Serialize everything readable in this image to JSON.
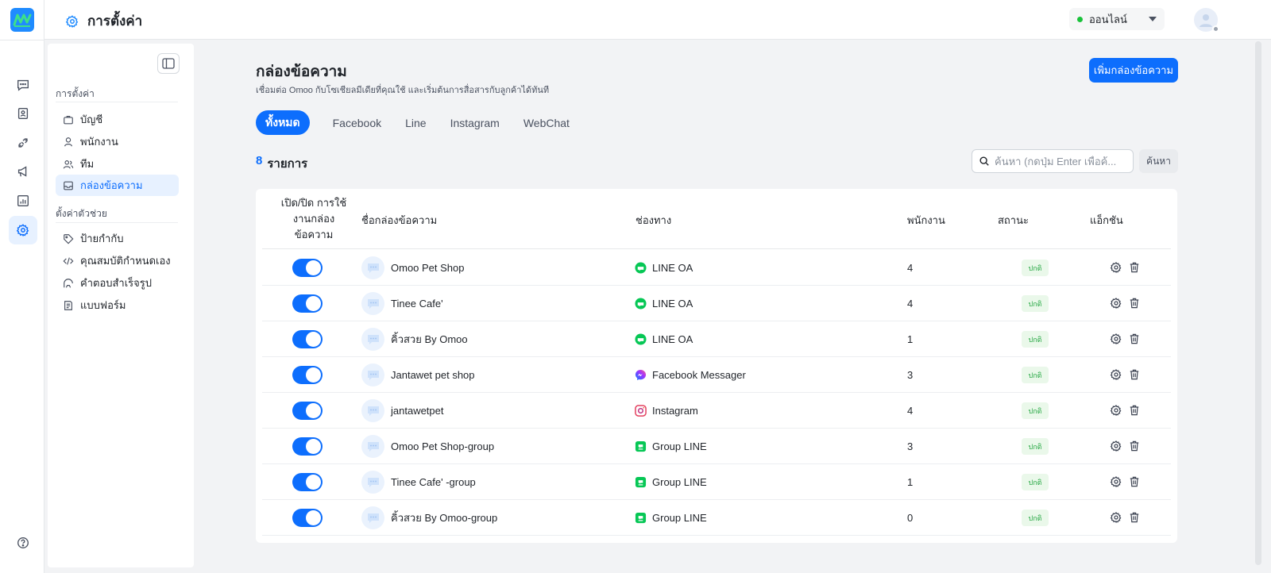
{
  "app": {
    "title": "การตั้งค่า"
  },
  "status": {
    "label": "ออนไลน์"
  },
  "settings_sidebar": {
    "group1": "การตั้งค่า",
    "items1": [
      {
        "label": "บัญชี"
      },
      {
        "label": "พนักงาน"
      },
      {
        "label": "ทีม"
      },
      {
        "label": "กล่องข้อความ"
      }
    ],
    "group2": "ตั้งค่าตัวช่วย",
    "items2": [
      {
        "label": "ป้ายกำกับ"
      },
      {
        "label": "คุณสมบัติกำหนดเอง"
      },
      {
        "label": "คำตอบสำเร็จรูป"
      },
      {
        "label": "แบบฟอร์ม"
      }
    ]
  },
  "main": {
    "title": "กล่องข้อความ",
    "subtitle": "เชื่อมต่อ Omoo กับโซเชียลมีเดียที่คุณใช้ และเริ่มต้นการสื่อสารกับลูกค้าได้ทันที",
    "add_button": "เพิ่มกล่องข้อความ",
    "tabs": [
      "ทั้งหมด",
      "Facebook",
      "Line",
      "Instagram",
      "WebChat"
    ],
    "count": "8",
    "count_label": "รายการ",
    "search_placeholder": "ค้นหา (กดปุ่ม Enter เพื่อค้...",
    "search_button": "ค้นหา"
  },
  "table": {
    "headers": {
      "toggle_line1": "เปิด/ปิด การใช้",
      "toggle_line2": "งานกล่อง",
      "toggle_line3": "ข้อความ",
      "name": "ชื่อกล่องข้อความ",
      "channel": "ช่องทาง",
      "staff": "พนักงาน",
      "status": "สถานะ",
      "action": "แอ็กชัน"
    },
    "rows": [
      {
        "name": "Omoo Pet Shop",
        "channel": "LINE OA",
        "channel_icon": "line-oa-icon",
        "staff": "4",
        "status": "ปกติ",
        "enabled": true
      },
      {
        "name": "Tinee Cafe'",
        "channel": "LINE OA",
        "channel_icon": "line-oa-icon",
        "staff": "4",
        "status": "ปกติ",
        "enabled": true
      },
      {
        "name": "คิ้วสวย By Omoo",
        "channel": "LINE OA",
        "channel_icon": "line-oa-icon",
        "staff": "1",
        "status": "ปกติ",
        "enabled": true
      },
      {
        "name": "Jantawet pet shop",
        "channel": "Facebook Messager",
        "channel_icon": "messenger-icon",
        "staff": "3",
        "status": "ปกติ",
        "enabled": true
      },
      {
        "name": "jantawetpet",
        "channel": "Instagram",
        "channel_icon": "instagram-icon",
        "staff": "4",
        "status": "ปกติ",
        "enabled": true
      },
      {
        "name": "Omoo Pet Shop-group",
        "channel": "Group LINE",
        "channel_icon": "group-line-icon",
        "staff": "3",
        "status": "ปกติ",
        "enabled": true
      },
      {
        "name": "Tinee Cafe' -group",
        "channel": "Group LINE",
        "channel_icon": "group-line-icon",
        "staff": "1",
        "status": "ปกติ",
        "enabled": true
      },
      {
        "name": "คิ้วสวย By Omoo-group",
        "channel": "Group LINE",
        "channel_icon": "group-line-icon",
        "staff": "0",
        "status": "ปกติ",
        "enabled": true
      }
    ]
  },
  "colors": {
    "accent": "#0d6efd",
    "online": "#19c23a",
    "line_green": "#06c755",
    "status_green": "#27a844"
  }
}
